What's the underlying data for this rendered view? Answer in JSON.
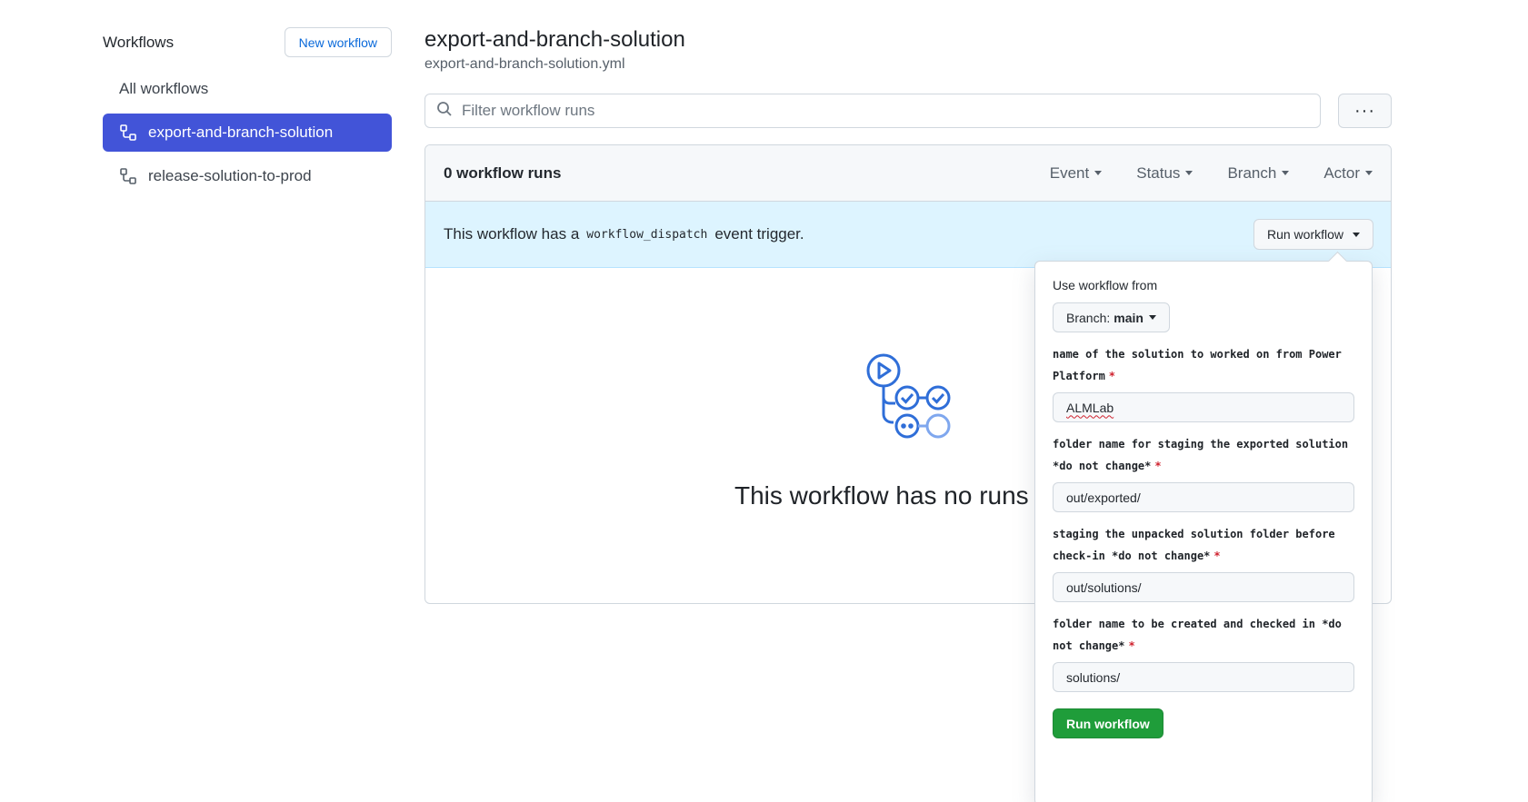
{
  "sidebar": {
    "title": "Workflows",
    "new_button": "New workflow",
    "all_workflows": "All workflows",
    "items": [
      {
        "label": "export-and-branch-solution",
        "active": true
      },
      {
        "label": "release-solution-to-prod",
        "active": false
      }
    ]
  },
  "header": {
    "title": "export-and-branch-solution",
    "file": "export-and-branch-solution.yml"
  },
  "filter": {
    "placeholder": "Filter workflow runs",
    "more_label": "···"
  },
  "runs": {
    "count_label": "0 workflow runs",
    "filters": [
      "Event",
      "Status",
      "Branch",
      "Actor"
    ],
    "dispatch": {
      "prefix": "This workflow has a",
      "code": "workflow_dispatch",
      "suffix": "event trigger."
    },
    "run_button": "Run workflow",
    "empty_title": "This workflow has no runs"
  },
  "panel": {
    "use_from_label": "Use workflow from",
    "branch_prefix": "Branch:",
    "branch_name": "main",
    "fields": [
      {
        "label": "name of the solution to worked on from Power Platform",
        "value": "ALMLab"
      },
      {
        "label": "folder name for staging the exported solution *do not change*",
        "value": "out/exported/"
      },
      {
        "label": "staging the unpacked solution folder before check-in *do not change*",
        "value": "out/solutions/"
      },
      {
        "label": "folder name to be created and checked in *do not change*",
        "value": "solutions/"
      }
    ],
    "required_mark": "*",
    "submit": "Run workflow"
  },
  "colors": {
    "accent": "#4254d8",
    "dispatch_bg": "#ddf4ff",
    "submit_green": "#1f9d3a",
    "icon_blue": "#2f6ed8"
  }
}
